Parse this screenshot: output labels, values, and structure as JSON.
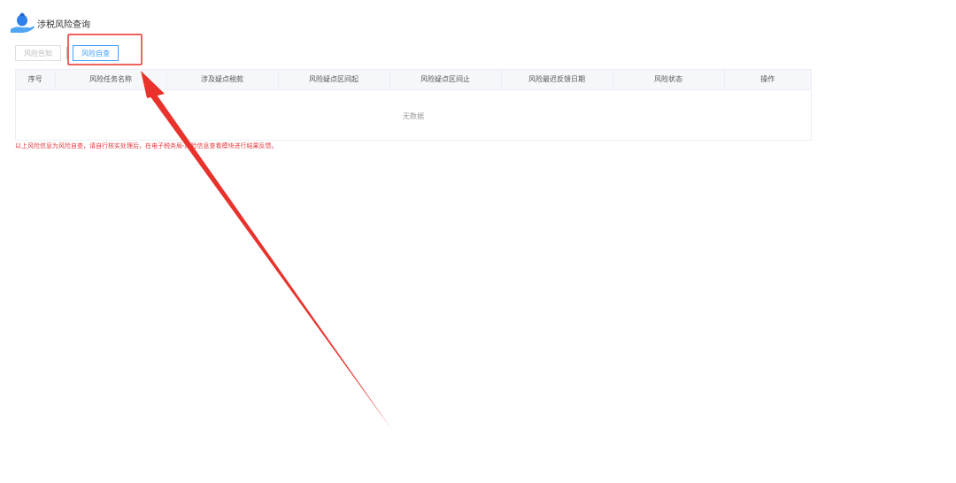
{
  "header": {
    "title": "涉税风险查询",
    "logo_icon": "money-bag-hand-icon"
  },
  "tabs": [
    {
      "label": "风险告知",
      "active": false
    },
    {
      "label": "风险自查",
      "active": true
    }
  ],
  "table": {
    "columns": [
      "序号",
      "风险任务名称",
      "涉及疑点税款",
      "风险疑点区间起",
      "风险疑点区间止",
      "风险最迟反馈日期",
      "风险状态",
      "操作"
    ],
    "empty_text": "无数据"
  },
  "note": "以上风险信息为风险自查，请自行核实处理后，在电子税务局-风险信息查看模块进行结果反馈。",
  "colors": {
    "accent": "#409eff",
    "note": "#e4393c",
    "annotation": "#e8322b",
    "header_bg": "#f5f7fa"
  }
}
